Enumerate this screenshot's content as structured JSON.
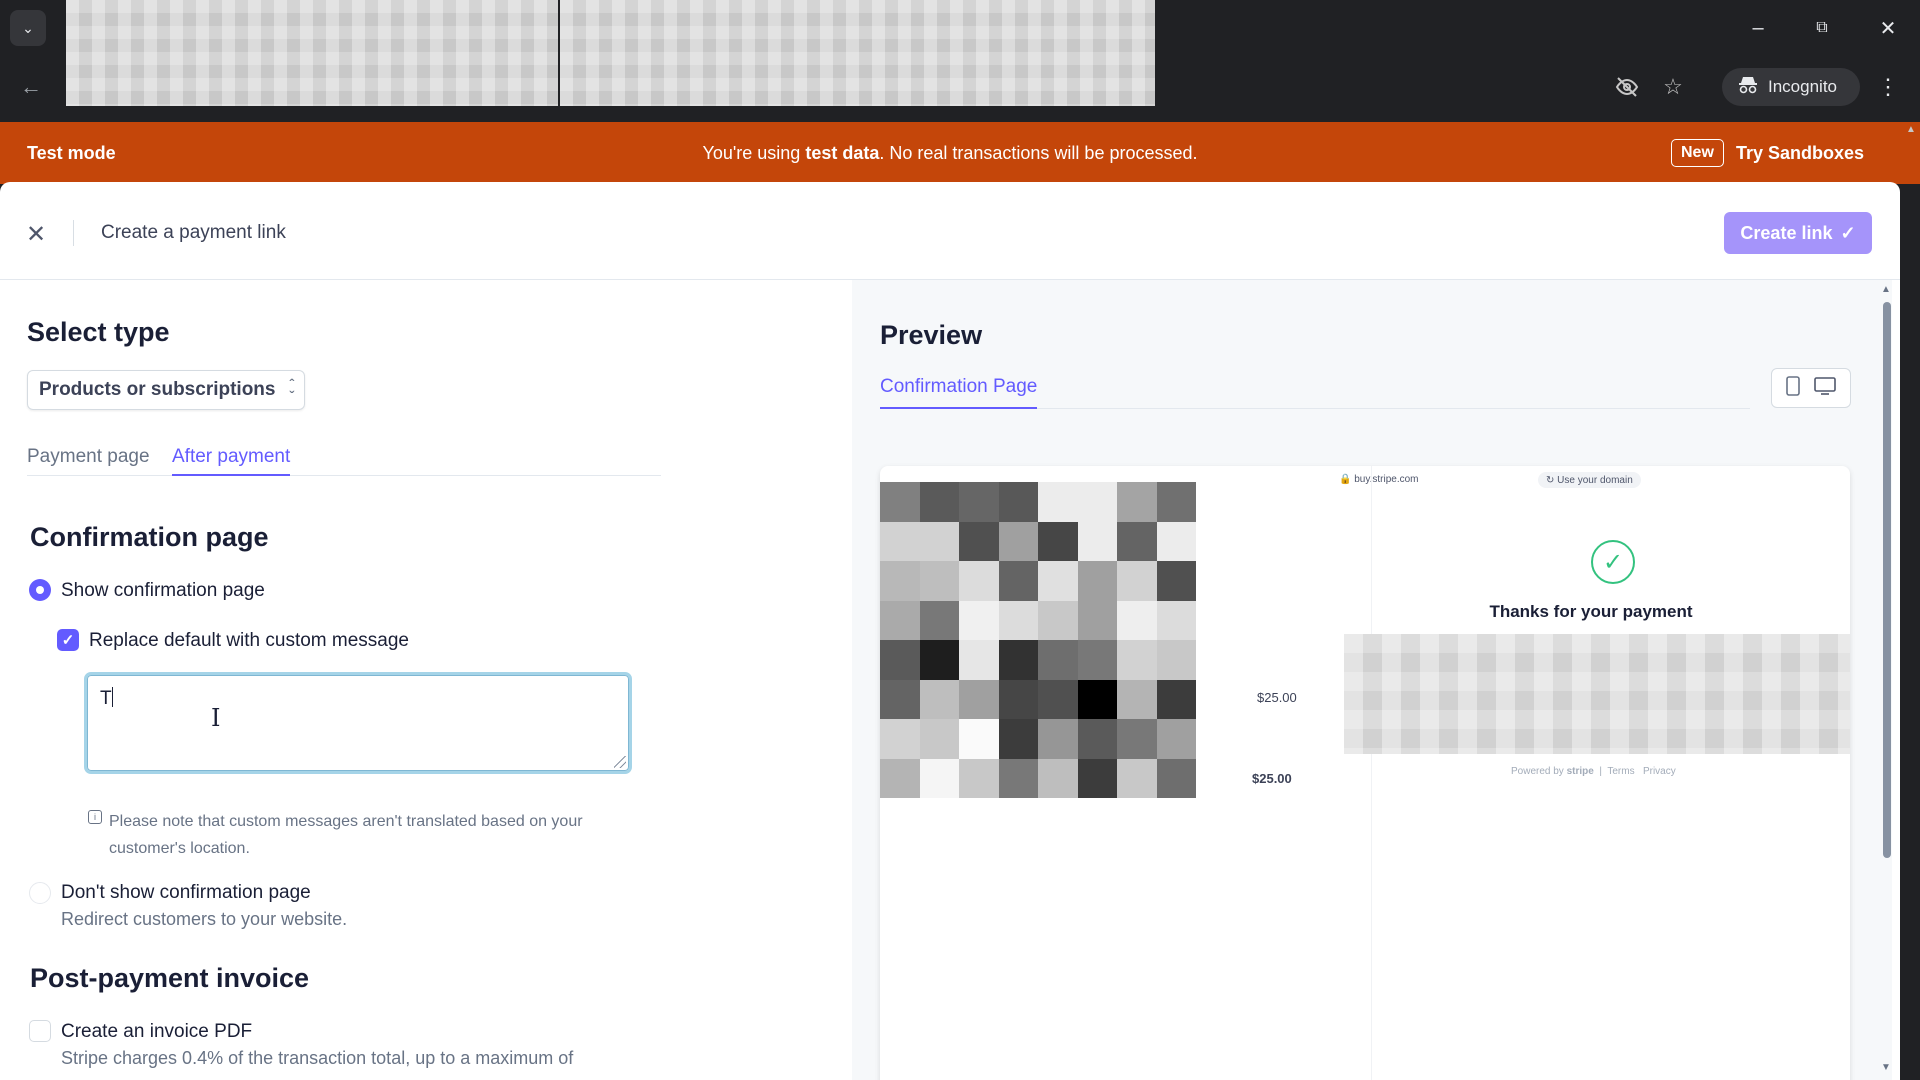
{
  "browser": {
    "incognito_label": "Incognito"
  },
  "banner": {
    "mode_label": "Test mode",
    "message_prefix": "You're using ",
    "message_bold": "test data",
    "message_suffix": ". No real transactions will be processed.",
    "new_badge": "New",
    "cta_label": "Try Sandboxes"
  },
  "header": {
    "title": "Create a payment link",
    "create_button": "Create link"
  },
  "form": {
    "select_type_heading": "Select type",
    "type_select_value": "Products or subscriptions",
    "tabs": [
      {
        "label": "Payment page",
        "active": false
      },
      {
        "label": "After payment",
        "active": true
      }
    ],
    "confirmation_heading": "Confirmation page",
    "show_confirmation_label": "Show confirmation page",
    "show_confirmation_selected": true,
    "replace_default_label": "Replace default with custom message",
    "replace_default_checked": true,
    "custom_message_value": "T",
    "note_text": "Please note that custom messages aren't translated based on your customer's location.",
    "dont_show_label": "Don't show confirmation page",
    "dont_show_sub": "Redirect customers to your website.",
    "invoice_heading": "Post-payment invoice",
    "invoice_label": "Create an invoice PDF",
    "invoice_checked": false,
    "invoice_sub": "Stripe charges 0.4% of the transaction total, up to a maximum of"
  },
  "preview": {
    "heading": "Preview",
    "tab_label": "Confirmation Page",
    "url_text": "buy.stripe.com",
    "domain_text": "Use your domain",
    "price_1": "$25.00",
    "price_2": "$25.00",
    "thanks_text": "Thanks for your payment",
    "footer_powered": "Powered by",
    "footer_brand": "stripe",
    "footer_terms": "Terms",
    "footer_privacy": "Privacy"
  },
  "colors": {
    "accent": "#635bff",
    "banner": "#c4460a",
    "create_button": "#a594fa",
    "success": "#33c27f"
  },
  "icons": {
    "tab_menu": "chevron-down-icon",
    "back": "arrow-left-icon",
    "eye_off": "eye-off-icon",
    "star": "star-icon",
    "incognito": "incognito-icon",
    "kebab": "more-vertical-icon",
    "close": "close-icon",
    "create_check": "check-icon",
    "select_chevrons": "chevron-updown-icon",
    "info": "info-icon",
    "mobile": "mobile-icon",
    "desktop": "desktop-icon",
    "success": "check-circle-icon",
    "lock": "lock-icon",
    "refresh": "refresh-icon"
  }
}
